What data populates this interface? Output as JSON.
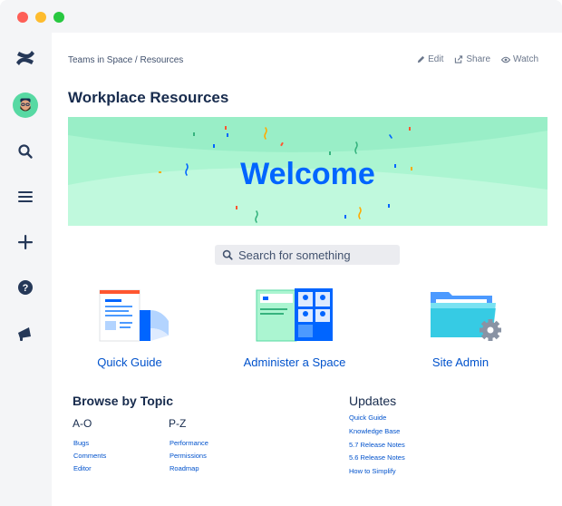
{
  "breadcrumb": "Teams in Space / Resources",
  "actions": [
    {
      "label": "Edit",
      "icon": "pencil-icon"
    },
    {
      "label": "Share",
      "icon": "share-icon"
    },
    {
      "label": "Watch",
      "icon": "eye-icon"
    }
  ],
  "page_title": "Workplace Resources",
  "banner": {
    "text": "Welcome",
    "bg_color": "#abf5d1",
    "text_color": "#0065ff"
  },
  "search": {
    "placeholder": "Search for something"
  },
  "cards": [
    {
      "label": "Quick Guide",
      "icon": "document-illustration"
    },
    {
      "label": "Administer a Space",
      "icon": "board-illustration"
    },
    {
      "label": "Site Admin",
      "icon": "folder-gear-illustration"
    }
  ],
  "browse": {
    "title": "Browse by Topic",
    "columns": [
      {
        "title": "A-O",
        "links": [
          "Bugs",
          "Comments",
          "Editor"
        ]
      },
      {
        "title": "P-Z",
        "links": [
          "Performance",
          "Permissions",
          "Roadmap"
        ]
      }
    ]
  },
  "updates": {
    "title": "Updates",
    "links": [
      "Quick Guide",
      "Knowledge Base",
      "5.7 Release Notes",
      "5.6 Release Notes",
      "How to Simplify"
    ]
  },
  "sidebar": [
    "confluence-logo-icon",
    "avatar",
    "search-icon",
    "menu-icon",
    "plus-icon",
    "help-icon",
    "megaphone-icon"
  ],
  "colors": {
    "link": "#0052cc",
    "text": "#172b4d",
    "sidebar_bg": "#f4f5f7"
  }
}
